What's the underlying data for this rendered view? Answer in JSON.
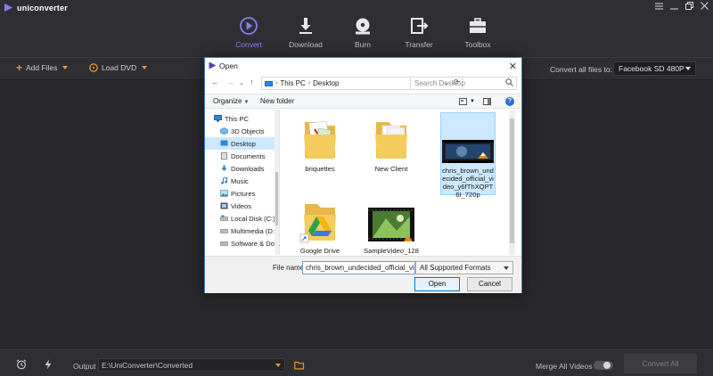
{
  "app": {
    "name": "uniconverter"
  },
  "nav": [
    {
      "label": "Convert",
      "icon": "convert-icon",
      "active": true
    },
    {
      "label": "Download",
      "icon": "download-icon",
      "active": false
    },
    {
      "label": "Burn",
      "icon": "burn-icon",
      "active": false
    },
    {
      "label": "Transfer",
      "icon": "transfer-icon",
      "active": false
    },
    {
      "label": "Toolbox",
      "icon": "toolbox-icon",
      "active": false
    }
  ],
  "toolbar": {
    "add_files": "Add Files",
    "load_dvd": "Load DVD",
    "convert_all_label": "Convert all files to:",
    "convert_all_value": "Facebook SD 480P"
  },
  "bottom": {
    "output_label": "Output",
    "output_path": "E:\\UniConverter\\Converted",
    "merge_label": "Merge All Videos",
    "merge_on": false,
    "convert_all_button": "Convert All"
  },
  "dialog": {
    "title": "Open",
    "breadcrumb": [
      "This PC",
      "Desktop"
    ],
    "search_placeholder": "Search Desktop",
    "organize": "Organize",
    "new_folder": "New folder",
    "help": "?",
    "tree": [
      {
        "label": "This PC",
        "icon": "pc-icon",
        "indent": 0
      },
      {
        "label": "3D Objects",
        "icon": "3d-objects-icon",
        "indent": 1
      },
      {
        "label": "Desktop",
        "icon": "desktop-icon",
        "indent": 1,
        "selected": true
      },
      {
        "label": "Documents",
        "icon": "documents-icon",
        "indent": 1
      },
      {
        "label": "Downloads",
        "icon": "downloads-icon",
        "indent": 1
      },
      {
        "label": "Music",
        "icon": "music-icon",
        "indent": 1
      },
      {
        "label": "Pictures",
        "icon": "pictures-icon",
        "indent": 1
      },
      {
        "label": "Videos",
        "icon": "videos-icon",
        "indent": 1
      },
      {
        "label": "Local Disk (C:)",
        "icon": "drive-icon",
        "indent": 1
      },
      {
        "label": "Multimedia (D:)",
        "icon": "drive-icon",
        "indent": 1
      },
      {
        "label": "Software & Docu",
        "icon": "drive-icon",
        "indent": 1
      }
    ],
    "files": [
      {
        "name": "briquettes",
        "kind": "folder-pdf"
      },
      {
        "name": "New Client",
        "kind": "folder"
      },
      {
        "name": "chris_brown_undecided_official_video_y6fThXQPT6I_720p",
        "kind": "video",
        "selected": true
      },
      {
        "name": "Google Drive",
        "kind": "shortcut-drive"
      },
      {
        "name": "SampleVideo_128",
        "kind": "video-green"
      }
    ],
    "file_name_label": "File name:",
    "file_name_value": "chris_brown_undecided_official_vi",
    "format": "All Supported Formats",
    "open_button": "Open",
    "cancel_button": "Cancel"
  },
  "colors": {
    "accent": "#8c7cf0",
    "orange": "#e4962f"
  }
}
